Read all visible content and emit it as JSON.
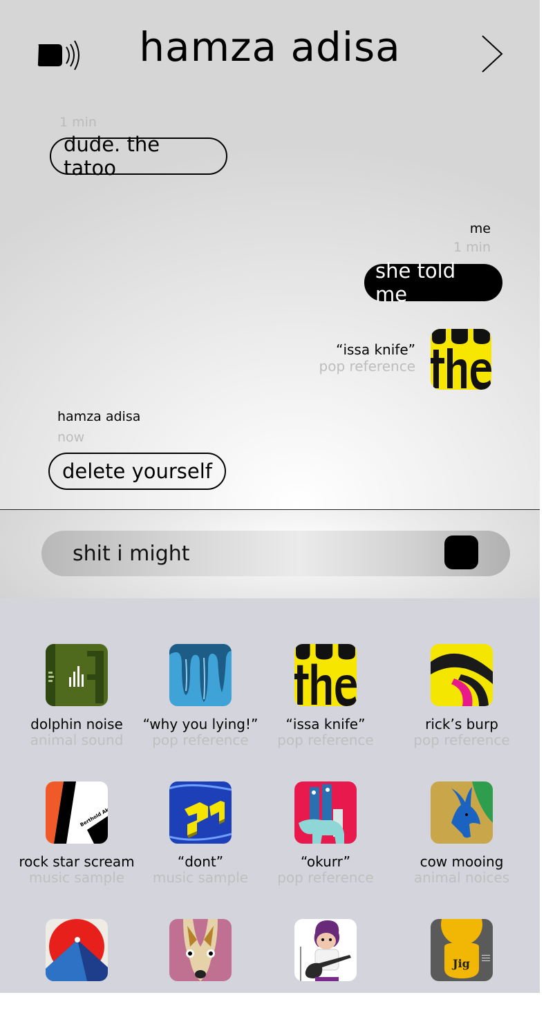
{
  "header": {
    "title": "hamza adisa"
  },
  "messages": [
    {
      "time": "1 min",
      "text": "dude. the tatoo"
    },
    {
      "sender": "me",
      "time": "1 min",
      "text": "she told me"
    },
    {
      "sticker_title": "“issa knife”",
      "sticker_sub": "pop reference",
      "icon": "the-album-art"
    },
    {
      "sender": "hamza adisa",
      "time": "now",
      "text": "delete yourself"
    }
  ],
  "composer": {
    "value": "shit i might"
  },
  "tray": {
    "rows": [
      [
        {
          "title": "dolphin noise",
          "sub": "animal sound",
          "icon": "fish-poster-art"
        },
        {
          "title": "“why you lying!”",
          "sub": "pop reference",
          "icon": "blue-drips-art"
        },
        {
          "title": "“issa knife”",
          "sub": "pop reference",
          "icon": "the-album-art"
        },
        {
          "title": "rick’s burp",
          "sub": "pop reference",
          "icon": "yellow-swirl-art"
        }
      ],
      [
        {
          "title": "rock star scream",
          "sub": "music sample",
          "icon": "akzidenz-grotesk-art"
        },
        {
          "title": "“dont”",
          "sub": "music sample",
          "icon": "blue-yellow-letters-art"
        },
        {
          "title": "“okurr”",
          "sub": "pop reference",
          "icon": "llamas-art"
        },
        {
          "title": "cow mooing",
          "sub": "animal noices",
          "icon": "antelope-art"
        }
      ],
      [
        {
          "icon": "red-blue-shapes-art"
        },
        {
          "icon": "giraffe-face-art"
        },
        {
          "icon": "guitar-player-art"
        },
        {
          "icon": "jig-yellow-art"
        }
      ]
    ],
    "sticker_label_text": "Berthold Akzidenz Grotesk",
    "jig_label_text": "Jig"
  },
  "colors": {
    "tray_bg": "#d4d5dc",
    "bubble_me": "#000000",
    "meta_gray": "#bbbbbb"
  }
}
